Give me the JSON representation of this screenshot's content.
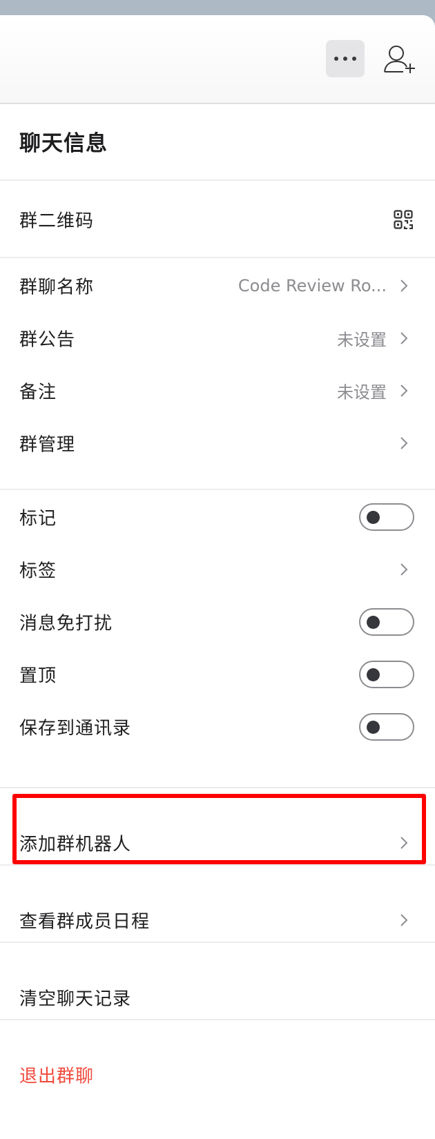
{
  "header": {
    "more_icon": "more-dots-icon",
    "add_member_icon": "add-person-icon"
  },
  "title": "聊天信息",
  "qr_row": {
    "label": "群二维码",
    "icon": "qr-code-icon"
  },
  "info_rows": [
    {
      "label": "群聊名称",
      "value": "Code Review Ro..."
    },
    {
      "label": "群公告",
      "value": "未设置"
    },
    {
      "label": "备注",
      "value": "未设置"
    },
    {
      "label": "群管理",
      "value": ""
    }
  ],
  "settings_rows": [
    {
      "label": "标记",
      "control": "toggle",
      "on": false
    },
    {
      "label": "标签",
      "control": "chevron"
    },
    {
      "label": "消息免打扰",
      "control": "toggle",
      "on": false
    },
    {
      "label": "置顶",
      "control": "toggle",
      "on": false
    },
    {
      "label": "保存到通讯录",
      "control": "toggle",
      "on": false
    }
  ],
  "add_bot": {
    "label": "添加群机器人"
  },
  "view_schedule": {
    "label": "查看群成员日程"
  },
  "clear_history": {
    "label": "清空聊天记录"
  },
  "exit_group": {
    "label": "退出群聊",
    "color": "#f04a3c"
  },
  "highlight_color": "#ff0000"
}
